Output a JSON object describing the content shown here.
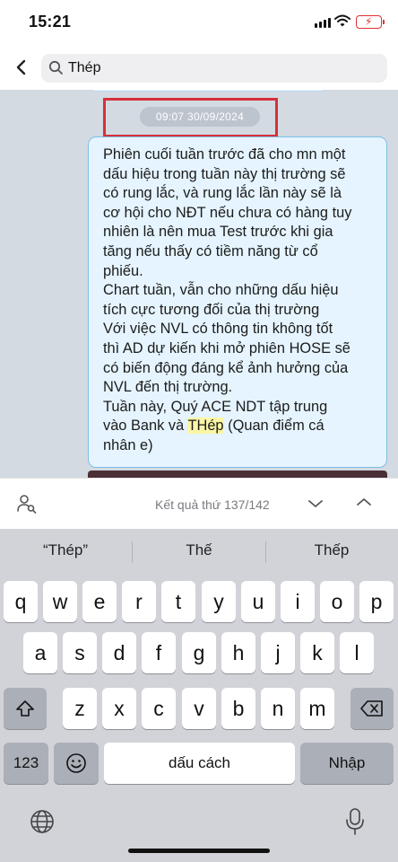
{
  "status_bar": {
    "time": "15:21"
  },
  "search": {
    "query": "Thép"
  },
  "chat": {
    "timestamp": "09:07 30/09/2024",
    "message_lines": [
      "Phiên cuối tuần trước đã cho mn một",
      "dấu hiệu trong tuần này thị trường sẽ",
      "có rung lắc, và rung lắc lần này sẽ là",
      "cơ hội cho NĐT nếu chưa có hàng tuy",
      "nhiên là nên mua Test trước khi gia",
      "tăng nếu thấy có tiềm năng từ cổ",
      "phiếu.",
      "Chart tuần, vẫn cho những dấu hiệu",
      "tích cực tương đối của thị trường",
      "Với việc NVL có thông tin không tốt",
      "thì AD dự kiến khi mở phiên HOSE sẽ",
      "có biến động đáng kể ảnh hưởng của",
      "NVL đến thị trường.",
      "Tuần này, Quý ACE NDT tập trung"
    ],
    "line15_before": "vào Bank và ",
    "line15_highlight": "THép",
    "line15_after": " (Quan điểm cá",
    "line16": "nhân e)",
    "highlight_color": "#fbf6a6"
  },
  "find_bar": {
    "result_text": "Kết quả thứ 137/142"
  },
  "keyboard": {
    "suggestions": [
      "“Thép”",
      "Thế",
      "Thếp"
    ],
    "row1": [
      "q",
      "w",
      "e",
      "r",
      "t",
      "y",
      "u",
      "i",
      "o",
      "p"
    ],
    "row2": [
      "a",
      "s",
      "d",
      "f",
      "g",
      "h",
      "j",
      "k",
      "l"
    ],
    "row3": [
      "z",
      "x",
      "c",
      "v",
      "b",
      "n",
      "m"
    ],
    "numbers_label": "123",
    "space_label": "dấu cách",
    "return_label": "Nhập"
  },
  "icons": {
    "back": "chevron-left-icon",
    "search": "magnifier-icon",
    "member_search": "person-search-icon",
    "down": "chevron-down-icon",
    "up": "chevron-up-icon",
    "shift": "shift-icon",
    "delete": "delete-icon",
    "emoji": "emoji-icon",
    "globe": "globe-icon",
    "mic": "microphone-icon"
  },
  "colors": {
    "bubble_bg": "#e5f4fe",
    "bubble_border": "#7ebfe4",
    "annotation_red": "#d6303b",
    "chat_bg": "#d3dae1"
  }
}
